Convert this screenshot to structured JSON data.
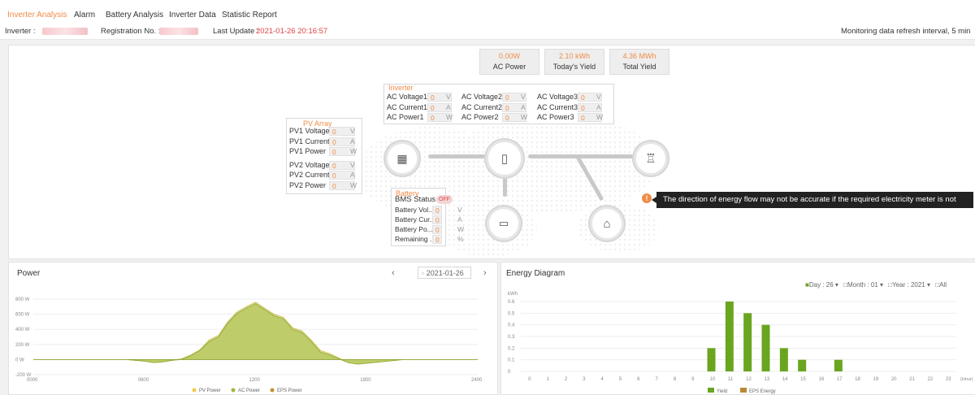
{
  "tabs": [
    "Inverter Analysis",
    "Alarm",
    "Battery Analysis",
    "Inverter Data",
    "Statistic Report"
  ],
  "info": {
    "inverter_label": "Inverter :",
    "registration_label": "Registration No. :",
    "last_update_label": "Last Update :",
    "last_update_value": "2021-01-26 20:16:57",
    "refresh_text": "Monitoring data refresh interval, 5 min"
  },
  "metrics": [
    {
      "value": "0.00W",
      "label": "AC Power"
    },
    {
      "value": "2.10 kWh",
      "label": "Today's Yield"
    },
    {
      "value": "4.36 MWh",
      "label": "Total Yield"
    }
  ],
  "inverter": {
    "title": "Inverter",
    "rows": [
      [
        "AC Voltage1",
        "0",
        "V",
        "AC Voltage2",
        "0",
        "V",
        "AC Voltage3",
        "0",
        "V"
      ],
      [
        "AC Current1",
        "0",
        "A",
        "AC Current2",
        "0",
        "A",
        "AC Current3",
        "0",
        "A"
      ],
      [
        "AC Power1",
        "0",
        "W",
        "AC Power2",
        "0",
        "W",
        "AC Power3",
        "0",
        "W"
      ]
    ]
  },
  "pv": {
    "title": "PV Array",
    "rows": [
      [
        "PV1 Voltage",
        "0",
        "V"
      ],
      [
        "PV1 Current",
        "0",
        "A"
      ],
      [
        "PV1 Power",
        "0",
        "W"
      ],
      [
        "PV2 Voltage",
        "0",
        "V"
      ],
      [
        "PV2 Current",
        "0",
        "A"
      ],
      [
        "PV2 Power",
        "0",
        "W"
      ]
    ]
  },
  "battery": {
    "title": "Battery",
    "bms_label": "BMS Status",
    "bms_value": "OFF",
    "rows": [
      [
        "Battery Vol...",
        "0",
        "V"
      ],
      [
        "Battery Cur...",
        "0",
        "A"
      ],
      [
        "Battery Po...",
        "0",
        "W"
      ],
      [
        "Remaining ...",
        "0",
        "%"
      ]
    ]
  },
  "tooltip": "The direction of energy flow may not be accurate if the required electricity meter is not installation.",
  "power_panel": {
    "title": "Power",
    "date": "2021-01-26",
    "prev_icon": "chevron-left-icon",
    "next_icon": "chevron-right-icon",
    "y_ticks": [
      "800 W",
      "600 W",
      "400 W",
      "200 W",
      "0 W",
      "-200 W"
    ],
    "x_ticks": [
      "0000",
      "0600",
      "1200",
      "1800",
      "2400"
    ],
    "legend": [
      "PV Power",
      "AC Power",
      "EPS Power"
    ],
    "colors": {
      "pv": "#f2c94c",
      "ac": "#9cbb3a",
      "eps": "#c8902a"
    }
  },
  "energy_panel": {
    "title": "Energy Diagram",
    "filters": {
      "day": "Day : 26",
      "month": "Month : 01",
      "year": "Year : 2021",
      "all": "All"
    },
    "y_unit": "kWh",
    "y_ticks": [
      "0.6",
      "0.5",
      "0.4",
      "0.3",
      "0.2",
      "0.1",
      "0"
    ],
    "x_unit": "(Hour)",
    "legend": [
      "Yield",
      "EPS Energy"
    ],
    "colors": {
      "yield": "#6aa51f",
      "eps": "#b98a35"
    }
  },
  "chart_data": [
    {
      "type": "area",
      "title": "Power",
      "xlabel": "",
      "ylabel": "",
      "ylim": [
        -200,
        800
      ],
      "x": [
        0,
        4,
        5,
        5.5,
        6,
        6.5,
        7,
        7.5,
        8,
        8.5,
        9,
        9.5,
        10,
        10.5,
        11,
        11.5,
        12,
        12.5,
        13,
        13.5,
        14,
        14.5,
        15,
        15.5,
        16,
        16.5,
        17,
        17.5,
        18,
        20,
        24
      ],
      "series": [
        {
          "name": "PV Power",
          "values": [
            0,
            0,
            0,
            -10,
            -20,
            -40,
            -30,
            -10,
            10,
            60,
            130,
            260,
            320,
            500,
            630,
            700,
            760,
            680,
            600,
            560,
            420,
            380,
            260,
            120,
            80,
            20,
            -40,
            -60,
            -50,
            0,
            0
          ]
        },
        {
          "name": "AC Power",
          "values": [
            0,
            0,
            0,
            -10,
            -20,
            -40,
            -30,
            -10,
            0,
            50,
            120,
            240,
            300,
            480,
            610,
            680,
            740,
            660,
            580,
            540,
            400,
            360,
            240,
            100,
            60,
            10,
            -40,
            -60,
            -50,
            0,
            0
          ]
        }
      ]
    },
    {
      "type": "bar",
      "title": "Energy Diagram",
      "xlabel": "(Hour)",
      "ylabel": "kWh",
      "ylim": [
        0,
        0.6
      ],
      "categories": [
        "0",
        "1",
        "2",
        "3",
        "4",
        "5",
        "6",
        "7",
        "8",
        "9",
        "10",
        "11",
        "12",
        "13",
        "14",
        "15",
        "16",
        "17",
        "18",
        "19",
        "20",
        "21",
        "22",
        "23"
      ],
      "series": [
        {
          "name": "Yield",
          "values": [
            0,
            0,
            0,
            0,
            0,
            0,
            0,
            0,
            0,
            0,
            0.2,
            0.6,
            0.5,
            0.4,
            0.2,
            0.1,
            0,
            0.1,
            0,
            0,
            0,
            0,
            0,
            0
          ]
        },
        {
          "name": "EPS Energy",
          "values": [
            0,
            0,
            0,
            0,
            0,
            0,
            0,
            0,
            0,
            0,
            0,
            0,
            0,
            0,
            0,
            0,
            0,
            0,
            0,
            0,
            0,
            0,
            0,
            0
          ]
        }
      ]
    }
  ]
}
